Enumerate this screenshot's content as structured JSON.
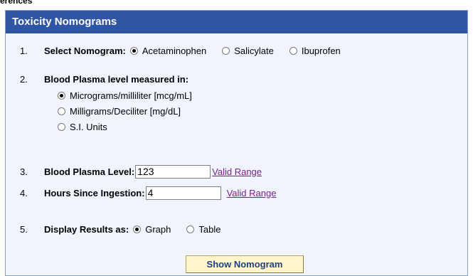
{
  "top_fragment": "erences",
  "panel": {
    "title": "Toxicity Nomograms"
  },
  "step1": {
    "number": "1.",
    "label": "Select Nomogram:",
    "options": [
      {
        "label": "Acetaminophen",
        "selected": true
      },
      {
        "label": "Salicylate",
        "selected": false
      },
      {
        "label": "Ibuprofen",
        "selected": false
      }
    ]
  },
  "step2": {
    "number": "2.",
    "label": "Blood Plasma level measured in:",
    "options": [
      {
        "label": "Micrograms/milliliter [mcg/mL]",
        "selected": true
      },
      {
        "label": "Milligrams/Deciliter [mg/dL]",
        "selected": false
      },
      {
        "label": "S.I. Units",
        "selected": false
      }
    ]
  },
  "step3": {
    "number": "3.",
    "label": "Blood Plasma Level:",
    "value": "123",
    "link": "Valid Range"
  },
  "step4": {
    "number": "4.",
    "label": "Hours Since Ingestion:",
    "value": "4",
    "link": "Valid Range"
  },
  "step5": {
    "number": "5.",
    "label": "Display Results as:",
    "options": [
      {
        "label": "Graph",
        "selected": true
      },
      {
        "label": "Table",
        "selected": false
      }
    ]
  },
  "button": {
    "label": "Show Nomogram"
  }
}
